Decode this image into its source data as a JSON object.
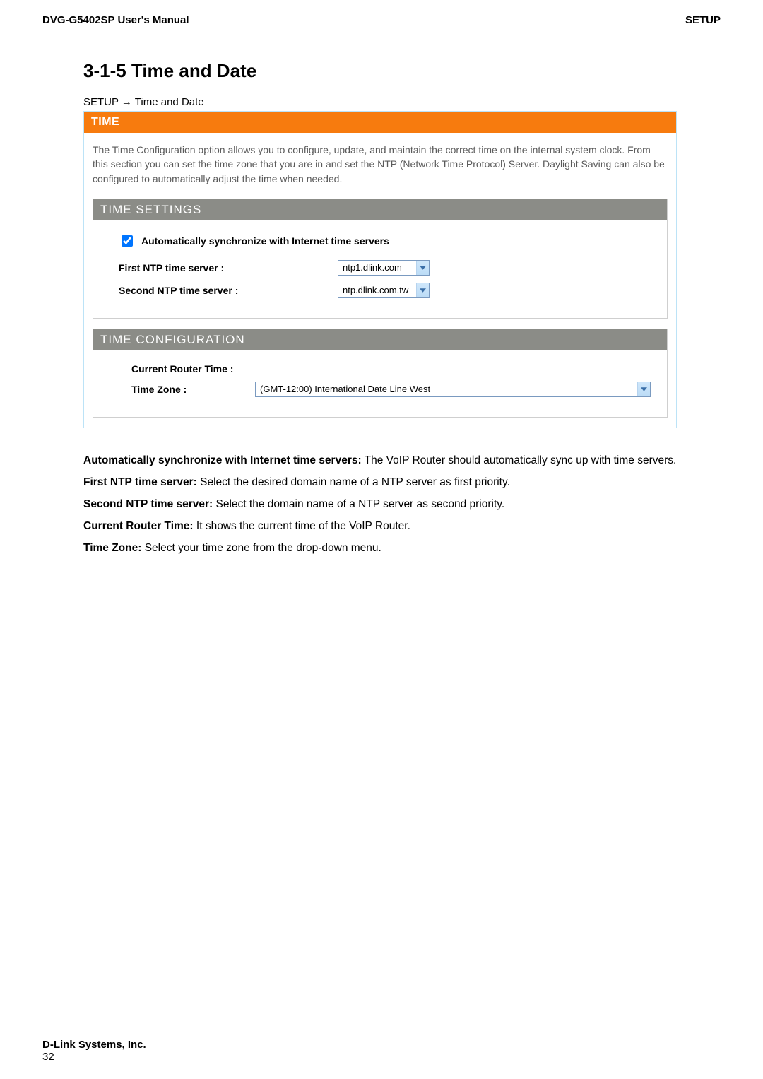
{
  "header": {
    "left": "DVG-G5402SP User's Manual",
    "right": "SETUP"
  },
  "heading": "3-1-5 Time and Date",
  "breadcrumb": "SETUP → Time and Date",
  "panel": {
    "title": "TIME",
    "description": "The Time Configuration option allows you to configure, update, and maintain the correct time on the internal system clock. From this section you can set the time zone that you are in and set the NTP (Network Time Protocol) Server. Daylight Saving can also be configured to automatically adjust the time when needed.",
    "time_settings": {
      "title": "TIME SETTINGS",
      "sync_checkbox_label": "Automatically synchronize with Internet time servers",
      "sync_checked": true,
      "first_ntp_label": "First NTP time server :",
      "first_ntp_value": "ntp1.dlink.com",
      "second_ntp_label": "Second NTP time server :",
      "second_ntp_value": "ntp.dlink.com.tw"
    },
    "time_config": {
      "title": "TIME CONFIGURATION",
      "current_router_time_label": "Current Router Time :",
      "current_router_time_value": "",
      "time_zone_label": "Time Zone :",
      "time_zone_value": "(GMT-12:00) International Date Line West"
    }
  },
  "body": {
    "p1_bold": "Automatically synchronize with Internet time servers:",
    "p1_rest": " The VoIP Router should automatically sync up with time servers.",
    "p2_bold": "First NTP time server:",
    "p2_rest": " Select the desired domain name of a NTP server as first priority.",
    "p3_bold": "Second NTP time server:",
    "p3_rest": " Select the domain name of a NTP server as second priority.",
    "p4_bold": "Current Router Time:",
    "p4_rest": " It shows the current time of the VoIP Router.",
    "p5_bold": "Time Zone:",
    "p5_rest": " Select your time zone from the drop-down menu."
  },
  "footer": {
    "company": "D-Link Systems, Inc.",
    "page": "32"
  },
  "icons": {
    "chevron_down": "chevron-down-icon"
  }
}
